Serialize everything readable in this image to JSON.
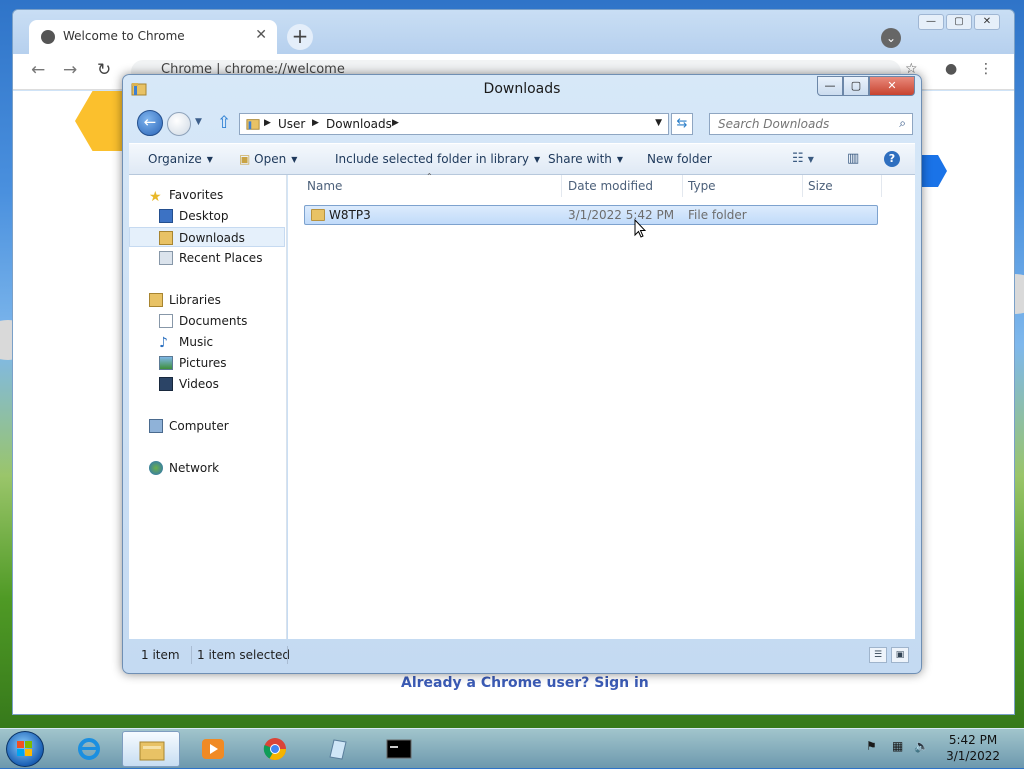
{
  "chrome": {
    "tab_title": "Welcome to Chrome",
    "tab_close": "✕",
    "new_tab": "+",
    "window_min": "—",
    "window_max": "▢",
    "window_close": "✕",
    "omnibox_text": "Chrome  |  chrome://welcome",
    "signin_text": "Already a Chrome user? Sign in"
  },
  "explorer": {
    "title": "Downloads",
    "window_min": "—",
    "window_max": "▢",
    "window_close": "✕",
    "breadcrumb": [
      "User",
      "Downloads"
    ],
    "search_placeholder": "Search Downloads",
    "commands": {
      "organize": "Organize",
      "open": "Open",
      "include": "Include selected folder in library",
      "share": "Share with",
      "new_folder": "New folder"
    },
    "nav": {
      "favorites_header": "Favorites",
      "favorites": [
        "Desktop",
        "Downloads",
        "Recent Places"
      ],
      "libraries_header": "Libraries",
      "libraries": [
        "Documents",
        "Music",
        "Pictures",
        "Videos"
      ],
      "computer": "Computer",
      "network": "Network",
      "selected": "Downloads"
    },
    "columns": {
      "name": "Name",
      "date": "Date modified",
      "type": "Type",
      "size": "Size"
    },
    "files": [
      {
        "name": "W8TP3",
        "date": "3/1/2022 5:42 PM",
        "type": "File folder",
        "size": ""
      }
    ],
    "status": {
      "count": "1 item",
      "selected": "1 item selected"
    }
  },
  "taskbar": {
    "apps": [
      "Windows Explorer",
      "Internet Explorer",
      "Windows Media Player",
      "Google Chrome",
      "Notepad",
      "Command Prompt"
    ],
    "clock_time": "5:42 PM",
    "clock_date": "3/1/2022"
  },
  "colors": {
    "accent": "#1a73e8",
    "selection": "#c1dbfa",
    "explorer_frame": "#c4daf2"
  }
}
